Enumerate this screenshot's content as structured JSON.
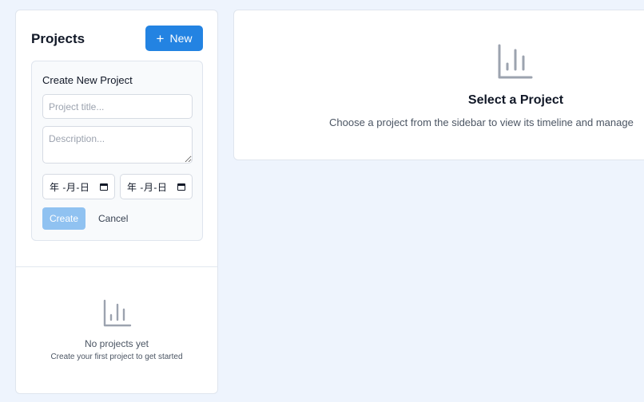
{
  "sidebar": {
    "title": "Projects",
    "new_button": {
      "icon": "plus-icon",
      "label": "New"
    },
    "create_form": {
      "title": "Create New Project",
      "title_placeholder": "Project title...",
      "description_placeholder": "Description...",
      "start_date_display": "年 -月-日",
      "end_date_display": "年 -月-日",
      "date_icon": "calendar-icon",
      "create_label": "Create",
      "cancel_label": "Cancel"
    },
    "empty_state": {
      "icon": "bar-chart-icon",
      "title": "No projects yet",
      "subtitle": "Create your first project to get started"
    }
  },
  "main": {
    "icon": "bar-chart-icon",
    "title": "Select a Project",
    "subtitle": "Choose a project from the sidebar to view its timeline and manage"
  },
  "colors": {
    "background": "#eef4fd",
    "accent": "#2383e2",
    "accent_disabled": "#90c2f1",
    "icon_gray": "#9ca3af"
  }
}
